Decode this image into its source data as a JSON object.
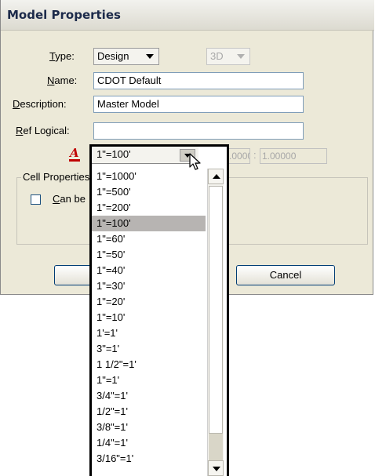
{
  "dialog": {
    "title": "Model Properties",
    "type_label": "Type:",
    "type_value": "Design",
    "dimension_value": "3D",
    "name_label": "Name:",
    "name_value": "CDOT Default",
    "description_label": "Description:",
    "description_value": "Master Model",
    "ref_logical_label": "Ref Logical:",
    "ref_logical_value": "",
    "annotation_scale_value": "1\"=100'",
    "scale_left": "100.0000",
    "scale_separator": ":",
    "scale_right": "1.00000",
    "cell_properties_label": "Cell Properties",
    "can_be_placed_label": "Can be",
    "ok_label": "",
    "cancel_label": "Cancel"
  },
  "dropdown": {
    "current": "1\"=100'",
    "selected_index": 3,
    "items": [
      "1\"=1000'",
      "1\"=500'",
      "1\"=200'",
      "1\"=100'",
      "1\"=60'",
      "1\"=50'",
      "1\"=40'",
      "1\"=30'",
      "1\"=20'",
      "1\"=10'",
      "1'=1'",
      "3\"=1'",
      "1 1/2\"=1'",
      "1\"=1'",
      "3/4\"=1'",
      "1/2\"=1'",
      "3/8\"=1'",
      "1/4\"=1'",
      "3/16\"=1'"
    ]
  },
  "colors": {
    "dialog_bg": "#ece9d8",
    "selected_item_bg": "#b7b4b2",
    "annotation_icon": "#c00000"
  },
  "icons": {
    "annotation_scale": "annotation-scale-icon",
    "cursor": "mouse-pointer-icon"
  }
}
